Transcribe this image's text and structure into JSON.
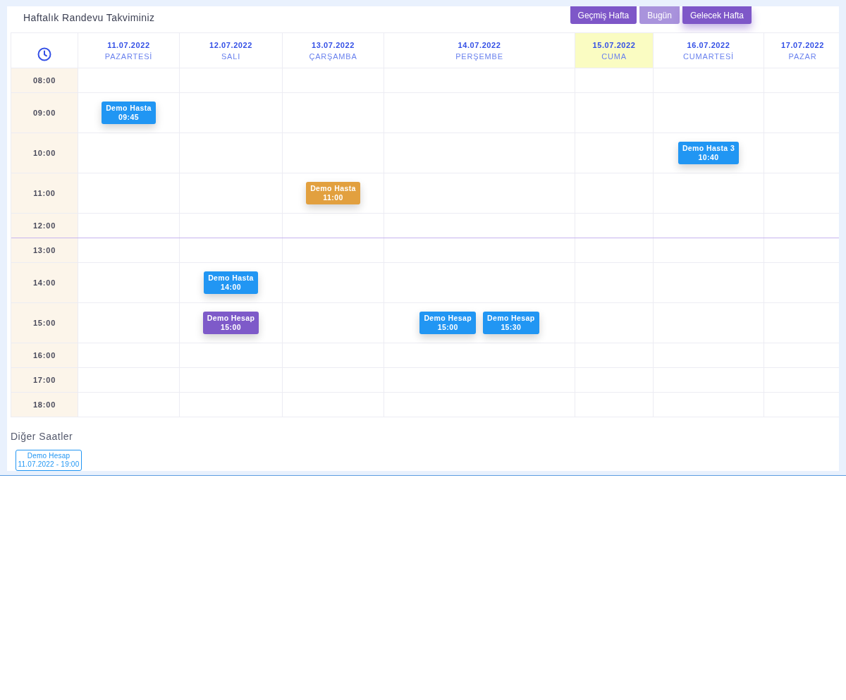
{
  "header": {
    "title": "Haftalık Randevu Takviminiz",
    "buttons": [
      {
        "label": "Geçmiş Hafta",
        "disabled": false,
        "focused": false
      },
      {
        "label": "Bugün",
        "disabled": true,
        "focused": false
      },
      {
        "label": "Gelecek Hafta",
        "disabled": false,
        "focused": true
      }
    ]
  },
  "calendar": {
    "days": [
      {
        "date": "11.07.2022",
        "weekday": "PAZARTESİ",
        "today": false
      },
      {
        "date": "12.07.2022",
        "weekday": "SALI",
        "today": false
      },
      {
        "date": "13.07.2022",
        "weekday": "ÇARŞAMBA",
        "today": false
      },
      {
        "date": "14.07.2022",
        "weekday": "PERŞEMBE",
        "today": false
      },
      {
        "date": "15.07.2022",
        "weekday": "CUMA",
        "today": true
      },
      {
        "date": "16.07.2022",
        "weekday": "CUMARTESİ",
        "today": false
      },
      {
        "date": "17.07.2022",
        "weekday": "PAZAR",
        "today": false
      }
    ],
    "rows": [
      {
        "time": "08:00",
        "break_line_above": false,
        "cells": [
          {},
          {},
          {},
          {},
          {},
          {},
          {}
        ]
      },
      {
        "time": "09:00",
        "break_line_above": false,
        "cells": [
          {
            "appointments": [
              {
                "name": "Demo Hasta",
                "time": "09:45",
                "color": "#2196f3"
              }
            ]
          },
          {},
          {},
          {},
          {},
          {},
          {}
        ]
      },
      {
        "time": "10:00",
        "break_line_above": false,
        "cells": [
          {},
          {},
          {},
          {},
          {},
          {
            "appointments": [
              {
                "name": "Demo Hasta 3",
                "time": "10:40",
                "color": "#2196f3"
              }
            ]
          },
          {}
        ]
      },
      {
        "time": "11:00",
        "break_line_above": false,
        "cells": [
          {},
          {},
          {
            "appointments": [
              {
                "name": "Demo Hasta",
                "time": "11:00",
                "color": "#e2a03f"
              }
            ]
          },
          {},
          {},
          {},
          {}
        ]
      },
      {
        "time": "12:00",
        "break_line_above": false,
        "cells": [
          {},
          {},
          {},
          {},
          {},
          {},
          {}
        ]
      },
      {
        "time": "13:00",
        "break_line_above": true,
        "cells": [
          {},
          {},
          {},
          {},
          {},
          {},
          {}
        ]
      },
      {
        "time": "14:00",
        "break_line_above": false,
        "cells": [
          {},
          {
            "appointments": [
              {
                "name": "Demo Hasta",
                "time": "14:00",
                "color": "#2196f3"
              }
            ]
          },
          {},
          {},
          {},
          {},
          {}
        ]
      },
      {
        "time": "15:00",
        "break_line_above": false,
        "cells": [
          {},
          {
            "appointments": [
              {
                "name": "Demo Hesap",
                "time": "15:00",
                "color": "#7e5ac9"
              }
            ]
          },
          {},
          {
            "appointments": [
              {
                "name": "Demo Hesap",
                "time": "15:00",
                "color": "#2196f3"
              },
              {
                "name": "Demo Hesap",
                "time": "15:30",
                "color": "#2196f3"
              }
            ]
          },
          {},
          {},
          {}
        ]
      },
      {
        "time": "16:00",
        "break_line_above": false,
        "cells": [
          {},
          {},
          {},
          {},
          {},
          {},
          {}
        ]
      },
      {
        "time": "17:00",
        "break_line_above": false,
        "cells": [
          {},
          {},
          {},
          {},
          {},
          {},
          {}
        ]
      },
      {
        "time": "18:00",
        "break_line_above": false,
        "cells": [
          {},
          {},
          {},
          {},
          {},
          {},
          {}
        ]
      }
    ]
  },
  "other_hours": {
    "title": "Diğer Saatler",
    "appointments": [
      {
        "name": "Demo Hesap",
        "when": "11.07.2022 - 19:00"
      }
    ]
  }
}
